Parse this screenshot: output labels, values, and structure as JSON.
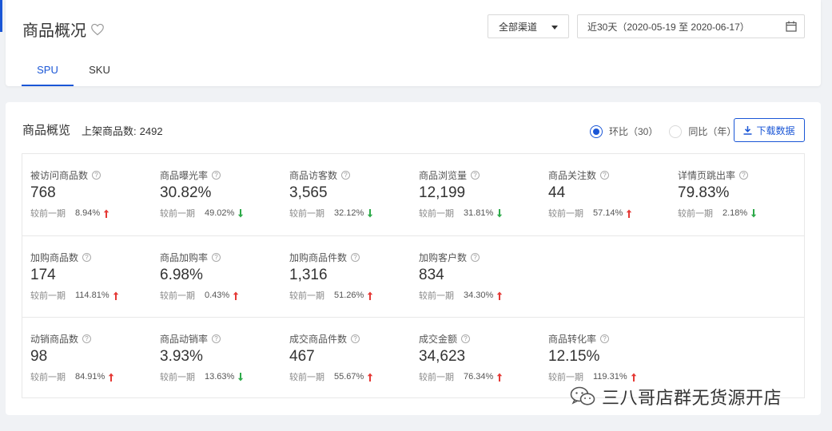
{
  "header": {
    "title": "商品概况",
    "channel": "全部渠道",
    "date_range": "近30天（2020-05-19 至 2020-06-17）",
    "tabs": [
      {
        "label": "SPU",
        "active": true
      },
      {
        "label": "SKU",
        "active": false
      }
    ]
  },
  "overview": {
    "title": "商品概览",
    "listed_label": "上架商品数:",
    "listed_value": "2492",
    "compare_options": [
      {
        "label": "环比（30）",
        "checked": true
      },
      {
        "label": "同比（年）",
        "checked": false
      }
    ],
    "download_label": "下载数据",
    "accent_color": "#1a56d6",
    "up_color": "#e53935",
    "down_color": "#2eaa4a"
  },
  "metrics": [
    [
      {
        "label": "被访问商品数",
        "value": "768",
        "compare": "较前一期",
        "pct": "8.94%",
        "trend": "up"
      },
      {
        "label": "商品曝光率",
        "value": "30.82%",
        "compare": "较前一期",
        "pct": "49.02%",
        "trend": "down"
      },
      {
        "label": "商品访客数",
        "value": "3,565",
        "compare": "较前一期",
        "pct": "32.12%",
        "trend": "down"
      },
      {
        "label": "商品浏览量",
        "value": "12,199",
        "compare": "较前一期",
        "pct": "31.81%",
        "trend": "down"
      },
      {
        "label": "商品关注数",
        "value": "44",
        "compare": "较前一期",
        "pct": "57.14%",
        "trend": "up"
      },
      {
        "label": "详情页跳出率",
        "value": "79.83%",
        "compare": "较前一期",
        "pct": "2.18%",
        "trend": "down"
      }
    ],
    [
      {
        "label": "加购商品数",
        "value": "174",
        "compare": "较前一期",
        "pct": "114.81%",
        "trend": "up"
      },
      {
        "label": "商品加购率",
        "value": "6.98%",
        "compare": "较前一期",
        "pct": "0.43%",
        "trend": "up"
      },
      {
        "label": "加购商品件数",
        "value": "1,316",
        "compare": "较前一期",
        "pct": "51.26%",
        "trend": "up"
      },
      {
        "label": "加购客户数",
        "value": "834",
        "compare": "较前一期",
        "pct": "34.30%",
        "trend": "up"
      }
    ],
    [
      {
        "label": "动销商品数",
        "value": "98",
        "compare": "较前一期",
        "pct": "84.91%",
        "trend": "up"
      },
      {
        "label": "商品动销率",
        "value": "3.93%",
        "compare": "较前一期",
        "pct": "13.63%",
        "trend": "down"
      },
      {
        "label": "成交商品件数",
        "value": "467",
        "compare": "较前一期",
        "pct": "55.67%",
        "trend": "up"
      },
      {
        "label": "成交金额",
        "value": "34,623",
        "compare": "较前一期",
        "pct": "76.34%",
        "trend": "up"
      },
      {
        "label": "商品转化率",
        "value": "12.15%",
        "compare": "较前一期",
        "pct": "119.31%",
        "trend": "up"
      }
    ]
  ],
  "watermark": {
    "icon": "wechat-icon",
    "text": "三八哥店群无货源开店"
  }
}
